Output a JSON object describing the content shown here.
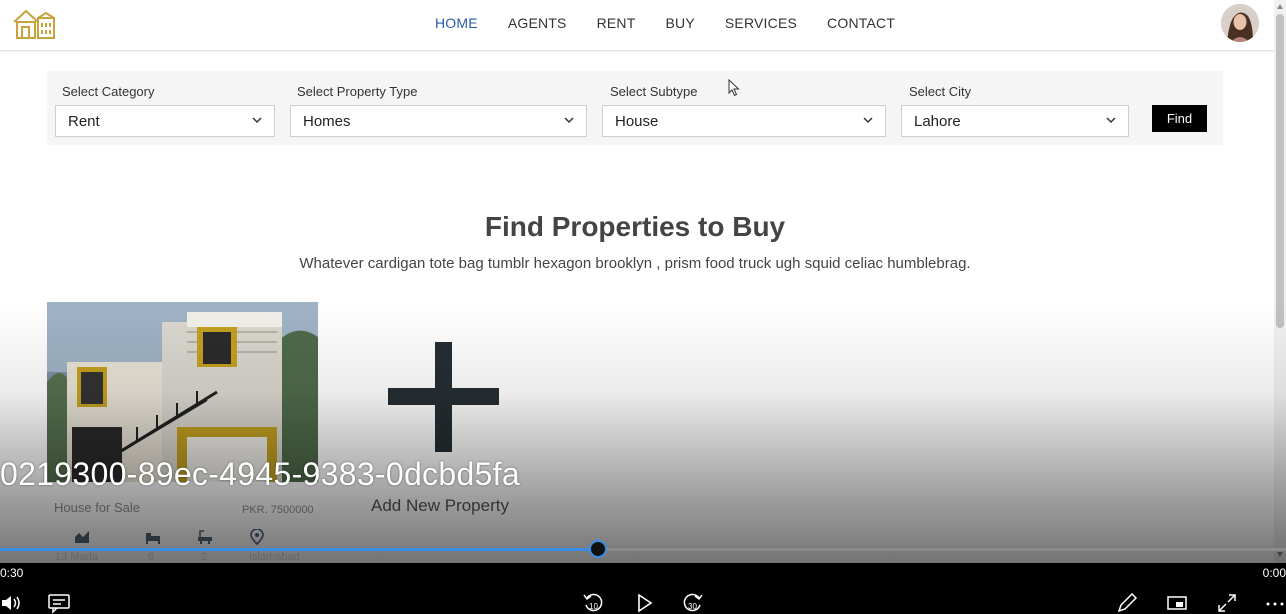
{
  "nav": {
    "items": [
      {
        "label": "HOME",
        "active": true
      },
      {
        "label": "AGENTS",
        "active": false
      },
      {
        "label": "RENT",
        "active": false
      },
      {
        "label": "BUY",
        "active": false
      },
      {
        "label": "SERVICES",
        "active": false
      },
      {
        "label": "CONTACT",
        "active": false
      }
    ],
    "active_color": "#2c5aa8",
    "logo_icon": "house-logo-icon",
    "avatar_icon": "user-avatar"
  },
  "filter": {
    "category": {
      "label": "Select Category",
      "value": "Rent"
    },
    "property_type": {
      "label": "Select Property Type",
      "value": "Homes"
    },
    "subtype": {
      "label": "Select Subtype",
      "value": "House"
    },
    "city": {
      "label": "Select City",
      "value": "Lahore"
    },
    "find_label": "Find"
  },
  "section": {
    "title": "Find Properties to Buy",
    "subtitle": "Whatever cardigan tote bag tumblr hexagon brooklyn , prism food truck ugh squid celiac humblebrag."
  },
  "property_card": {
    "title": "House for Sale",
    "price": "PKR. 7500000",
    "area": "13 Marla",
    "beds": "6",
    "baths": "2",
    "location": "Islamabad"
  },
  "add_property": {
    "label": "Add New Property"
  },
  "video": {
    "caption": "0219300-89ec-4945-9383-0dcbd5fa",
    "time_elapsed": "0:30",
    "time_remaining": "0:00",
    "progress": 0.465,
    "accent": "#3a8ee6",
    "skip_back_label": "10",
    "skip_forward_label": "30"
  }
}
